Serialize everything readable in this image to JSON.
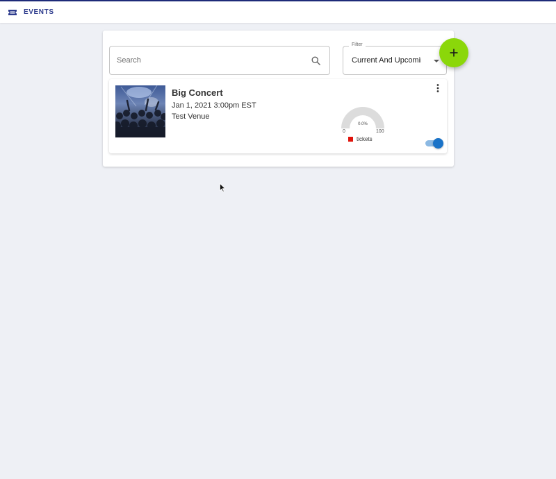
{
  "colors": {
    "nav_accent": "#2c3a8c",
    "fab": "#8bd70a",
    "toggle_on": "#1a73c8",
    "legend_tickets": "#e0140c",
    "gauge_bg": "#dcdcdc"
  },
  "nav": {
    "icon": "ticket-icon",
    "label": "EVENTS"
  },
  "search": {
    "placeholder": "Search",
    "value": "",
    "icon": "search-icon"
  },
  "filter": {
    "label": "Filter",
    "selected": "Current And Upcoming"
  },
  "fab": {
    "icon": "plus-icon"
  },
  "events": [
    {
      "title": "Big Concert",
      "date": "Jan 1, 2021 3:00pm EST",
      "venue": "Test Venue",
      "image": "concert-crowd-photo",
      "gauge": {
        "percent_text": "0.0%",
        "percent": 0,
        "min": "0",
        "max": "100"
      },
      "legend": "tickets",
      "enabled": true,
      "menu_icon": "more-vert-icon"
    }
  ]
}
